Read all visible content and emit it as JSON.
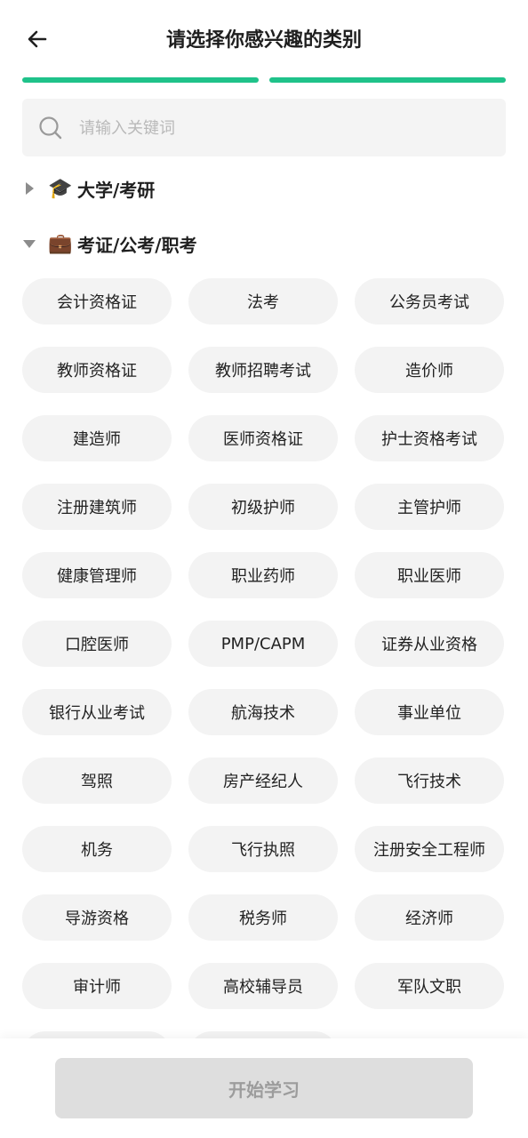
{
  "header": {
    "title": "请选择你感兴趣的类别",
    "back_icon": "arrow-left-icon"
  },
  "progress": {
    "steps_total": 2,
    "steps_completed": 2,
    "color": "#1fc28a"
  },
  "search": {
    "placeholder": "请输入关键词",
    "value": "",
    "icon": "search-icon"
  },
  "categories": [
    {
      "label": "大学/考研",
      "emoji": "🎓",
      "expanded": false
    },
    {
      "label": "考证/公考/职考",
      "emoji": "💼",
      "expanded": true
    }
  ],
  "tags": [
    "会计资格证",
    "法考",
    "公务员考试",
    "教师资格证",
    "教师招聘考试",
    "造价师",
    "建造师",
    "医师资格证",
    "护士资格考试",
    "注册建筑师",
    "初级护师",
    "主管护师",
    "健康管理师",
    "职业药师",
    "职业医师",
    "口腔医师",
    "PMP/CAPM",
    "证券从业资格",
    "银行从业考试",
    "航海技术",
    "事业单位",
    "驾照",
    "房产经纪人",
    "飞行技术",
    "机务",
    "飞行执照",
    "注册安全工程师",
    "导游资格",
    "税务师",
    "经济师",
    "审计师",
    "高校辅导员",
    "军队文职"
  ],
  "footer": {
    "start_button": "开始学习",
    "start_button_enabled": false
  },
  "colors": {
    "accent": "#1fc28a",
    "tag_bg": "#f3f3f3",
    "search_bg": "#f4f4f4",
    "button_disabled_bg": "#dedede",
    "button_disabled_text": "#9c9c9c"
  }
}
